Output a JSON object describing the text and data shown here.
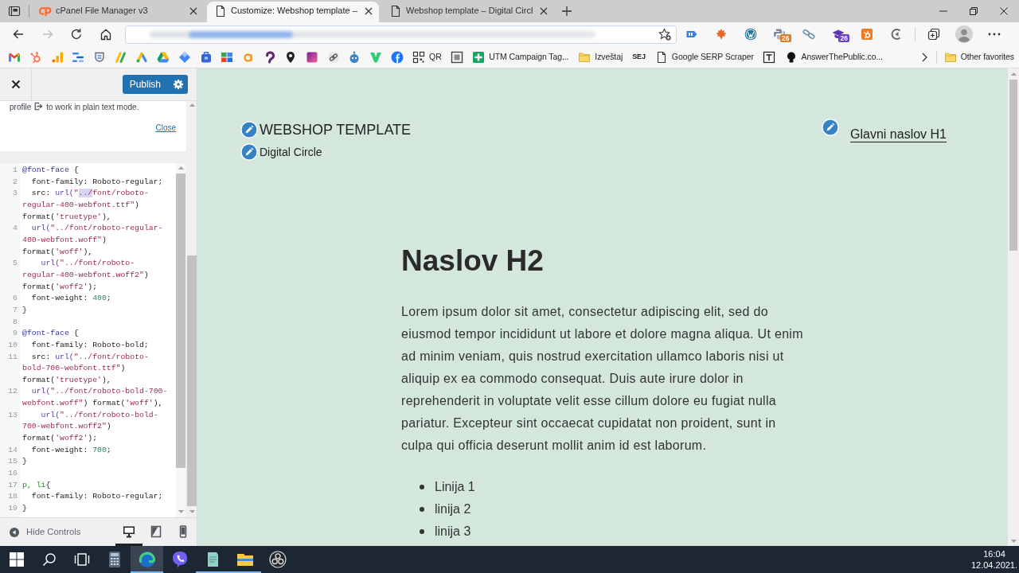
{
  "browser": {
    "tabs": [
      {
        "title": "cPanel File Manager v3",
        "kind": "cpanel",
        "selected": false
      },
      {
        "title": "Customize: Webshop template –",
        "kind": "page",
        "selected": true
      },
      {
        "title": "Webshop template – Digital Circl",
        "kind": "page",
        "selected": false
      }
    ],
    "nav": [
      {
        "kind": "back",
        "disabled": false
      },
      {
        "kind": "forward",
        "disabled": true
      },
      {
        "kind": "reload",
        "disabled": false
      },
      {
        "kind": "home",
        "disabled": false
      }
    ],
    "extensions": [
      {
        "kind": "tag"
      },
      {
        "kind": "leaf"
      },
      {
        "kind": "wordpress"
      },
      {
        "kind": "python",
        "badge": "26"
      },
      {
        "kind": "chain"
      },
      {
        "kind": "cap",
        "badge": "26"
      },
      {
        "kind": "sprocket"
      },
      {
        "kind": "arc"
      }
    ],
    "bookmarks": [
      {
        "kind": "gmail"
      },
      {
        "kind": "hubspot"
      },
      {
        "kind": "analytics"
      },
      {
        "kind": "lines"
      },
      {
        "kind": "shield"
      },
      {
        "kind": "adsense"
      },
      {
        "kind": "ads"
      },
      {
        "kind": "drive"
      },
      {
        "kind": "diamond"
      },
      {
        "kind": "bag"
      },
      {
        "kind": "blocks"
      },
      {
        "kind": "amazon"
      },
      {
        "kind": "hook"
      },
      {
        "kind": "pin"
      },
      {
        "kind": "gradient"
      },
      {
        "kind": "chain"
      },
      {
        "kind": "robot"
      },
      {
        "kind": "vee"
      },
      {
        "kind": "facebook"
      },
      {
        "kind": "qr",
        "label": "QR"
      },
      {
        "kind": "frame"
      },
      {
        "kind": "plus",
        "label": "UTM Campaign Tag..."
      },
      {
        "kind": "folder",
        "label": "Izveštaj"
      },
      {
        "kind": "sej",
        "label": "SEJ"
      },
      {
        "kind": "page",
        "label": "Google SERP Scraper"
      },
      {
        "kind": "boxed"
      },
      {
        "kind": "bulb",
        "label": "AnswerThePublic.co..."
      }
    ],
    "other_favorites": {
      "label": "Other favorites"
    }
  },
  "customizer": {
    "publish": "Publish",
    "notice": {
      "link": "profile",
      "text": "to work in plain text mode.",
      "close": "Close"
    },
    "code": [
      {
        "number": "1",
        "rows": [
          {
            "tokens": [
              {
                "kind": "atrule",
                "text": "@font-face"
              },
              {
                "kind": "plain",
                "text": " {"
              }
            ]
          }
        ]
      },
      {
        "number": "2",
        "rows": [
          {
            "tokens": [
              {
                "kind": "plain",
                "text": "  font-family: Roboto-regular;"
              }
            ]
          }
        ]
      },
      {
        "number": "3",
        "rows": [
          {
            "tokens": [
              {
                "kind": "plain",
                "text": "  src: "
              },
              {
                "kind": "function",
                "text": "url("
              },
              {
                "kind": "string",
                "text": "\""
              },
              {
                "kind": "selection",
                "text": "../"
              },
              {
                "kind": "string",
                "text": "font/roboto-"
              }
            ]
          },
          {
            "tokens": [
              {
                "kind": "string",
                "text": "regular-400-webfont.ttf\""
              },
              {
                "kind": "plain",
                "text": ")"
              }
            ]
          },
          {
            "tokens": [
              {
                "kind": "plain",
                "text": "format("
              },
              {
                "kind": "string",
                "text": "'truetype'"
              },
              {
                "kind": "plain",
                "text": "),"
              }
            ]
          }
        ]
      },
      {
        "number": "4",
        "rows": [
          {
            "tokens": [
              {
                "kind": "function",
                "text": "  url("
              },
              {
                "kind": "string",
                "text": "\"../font/roboto-regular-"
              }
            ]
          },
          {
            "tokens": [
              {
                "kind": "string",
                "text": "400-webfont.woff\""
              },
              {
                "kind": "plain",
                "text": ")"
              }
            ]
          },
          {
            "tokens": [
              {
                "kind": "plain",
                "text": "format("
              },
              {
                "kind": "string",
                "text": "'woff'"
              },
              {
                "kind": "plain",
                "text": "),"
              }
            ]
          }
        ]
      },
      {
        "number": "5",
        "rows": [
          {
            "tokens": [
              {
                "kind": "function",
                "text": "    url("
              },
              {
                "kind": "string",
                "text": "\"../font/roboto-"
              }
            ]
          },
          {
            "tokens": [
              {
                "kind": "string",
                "text": "regular-400-webfont.woff2\""
              },
              {
                "kind": "plain",
                "text": ")"
              }
            ]
          },
          {
            "tokens": [
              {
                "kind": "plain",
                "text": "format("
              },
              {
                "kind": "string",
                "text": "'woff2'"
              },
              {
                "kind": "plain",
                "text": ");"
              }
            ]
          }
        ]
      },
      {
        "number": "6",
        "rows": [
          {
            "tokens": [
              {
                "kind": "plain",
                "text": "  font-weight: "
              },
              {
                "kind": "number",
                "text": "400"
              },
              {
                "kind": "plain",
                "text": ";"
              }
            ]
          }
        ]
      },
      {
        "number": "7",
        "rows": [
          {
            "tokens": [
              {
                "kind": "plain",
                "text": "}"
              }
            ]
          }
        ]
      },
      {
        "number": "8"
      },
      {
        "number": "9",
        "rows": [
          {
            "tokens": [
              {
                "kind": "atrule",
                "text": "@font-face"
              },
              {
                "kind": "plain",
                "text": " {"
              }
            ]
          }
        ]
      },
      {
        "number": "10",
        "rows": [
          {
            "tokens": [
              {
                "kind": "plain",
                "text": "  font-family: Roboto-bold;"
              }
            ]
          }
        ]
      },
      {
        "number": "11",
        "rows": [
          {
            "tokens": [
              {
                "kind": "plain",
                "text": "  src: "
              },
              {
                "kind": "function",
                "text": "url("
              },
              {
                "kind": "string",
                "text": "\"../font/roboto-"
              }
            ]
          },
          {
            "tokens": [
              {
                "kind": "string",
                "text": "bold-700-webfont.ttf\""
              },
              {
                "kind": "plain",
                "text": ")"
              }
            ]
          },
          {
            "tokens": [
              {
                "kind": "plain",
                "text": "format("
              },
              {
                "kind": "string",
                "text": "'truetype'"
              },
              {
                "kind": "plain",
                "text": "),"
              }
            ]
          }
        ]
      },
      {
        "number": "12",
        "rows": [
          {
            "tokens": [
              {
                "kind": "function",
                "text": "  url("
              },
              {
                "kind": "string",
                "text": "\"../font/roboto-bold-700-"
              }
            ]
          },
          {
            "tokens": [
              {
                "kind": "string",
                "text": "webfont.woff\""
              },
              {
                "kind": "plain",
                "text": ") format("
              },
              {
                "kind": "string",
                "text": "'woff'"
              },
              {
                "kind": "plain",
                "text": "),"
              }
            ]
          }
        ]
      },
      {
        "number": "13",
        "rows": [
          {
            "tokens": [
              {
                "kind": "function",
                "text": "    url("
              },
              {
                "kind": "string",
                "text": "\"../font/roboto-bold-"
              }
            ]
          },
          {
            "tokens": [
              {
                "kind": "string",
                "text": "700-webfont.woff2\""
              },
              {
                "kind": "plain",
                "text": ")"
              }
            ]
          },
          {
            "tokens": [
              {
                "kind": "plain",
                "text": "format("
              },
              {
                "kind": "string",
                "text": "'woff2'"
              },
              {
                "kind": "plain",
                "text": ");"
              }
            ]
          }
        ]
      },
      {
        "number": "14",
        "rows": [
          {
            "tokens": [
              {
                "kind": "plain",
                "text": "  font-weight: "
              },
              {
                "kind": "number",
                "text": "700"
              },
              {
                "kind": "plain",
                "text": ";"
              }
            ]
          }
        ]
      },
      {
        "number": "15",
        "rows": [
          {
            "tokens": [
              {
                "kind": "plain",
                "text": "}"
              }
            ]
          }
        ]
      },
      {
        "number": "16"
      },
      {
        "number": "17",
        "rows": [
          {
            "tokens": [
              {
                "kind": "tag",
                "text": "p, li"
              },
              {
                "kind": "plain",
                "text": "{"
              }
            ]
          }
        ]
      },
      {
        "number": "18",
        "rows": [
          {
            "tokens": [
              {
                "kind": "plain",
                "text": "  font-family: Roboto-regular;"
              }
            ]
          }
        ]
      },
      {
        "number": "19",
        "rows": [
          {
            "tokens": [
              {
                "kind": "plain",
                "text": "}"
              }
            ]
          }
        ]
      }
    ],
    "hide_controls": "Hide Controls",
    "devices": [
      {
        "kind": "desktop",
        "selected": true
      },
      {
        "kind": "tablet",
        "selected": false
      },
      {
        "kind": "mobile",
        "selected": false
      }
    ]
  },
  "preview": {
    "site_title": "WEBSHOP TEMPLATE",
    "tagline": "Digital Circle",
    "menu": [
      {
        "label": "Glavni naslov H1"
      }
    ],
    "heading": "Naslov H2",
    "paragraph": "Lorem ipsum dolor sit amet, consectetur adipiscing elit, sed do eiusmod tempor incididunt ut labore et dolore magna aliqua. Ut enim ad minim veniam, quis nostrud exercitation ullamco laboris nisi ut aliquip ex ea commodo consequat. Duis aute irure dolor in reprehenderit in voluptate velit esse cillum dolore eu fugiat nulla pariatur. Excepteur sint occaecat cupidatat non proident, sunt in culpa qui officia deserunt mollit anim id est laborum.",
    "list": [
      "Linija 1",
      "linija 2",
      "linija 3"
    ]
  },
  "taskbar": {
    "apps": [
      {
        "kind": "calculator",
        "running": false,
        "selected": false
      },
      {
        "kind": "edge",
        "running": true,
        "selected": true
      },
      {
        "kind": "viber",
        "running": false,
        "selected": false
      },
      {
        "kind": "notepad",
        "running": true,
        "selected": false
      },
      {
        "kind": "explorer",
        "running": true,
        "selected": false
      },
      {
        "kind": "obs",
        "running": false,
        "selected": false
      }
    ],
    "time": "16:04",
    "date": "12.04.2021."
  }
}
